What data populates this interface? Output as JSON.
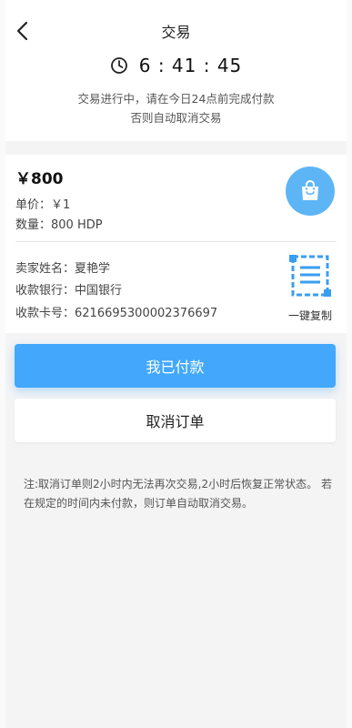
{
  "header": {
    "title": "交易",
    "timer": "6 : 41 : 45",
    "notice_line1": "交易进行中，请在今日24点前完成付款",
    "notice_line2": "否则自动取消交易"
  },
  "order": {
    "amount": "￥800",
    "unit_price": "单价：￥1",
    "quantity": "数量：800 HDP",
    "seller_name": "卖家姓名：夏艳学",
    "bank": "收款银行：中国银行",
    "card_number": "收款卡号：6216695300002376697",
    "copy_label": "一键复制"
  },
  "actions": {
    "paid_label": "我已付款",
    "cancel_label": "取消订单"
  },
  "footer": {
    "note": "注:取消订单则2小时内无法再次交易,2小时后恢复正常状态。 若在规定的时间内未付款，则订单自动取消交易。"
  },
  "colors": {
    "accent": "#43a8fb",
    "bag_icon_bg": "#5db5f5",
    "background": "#f4f4f5"
  },
  "icons": {
    "back": "chevron-left-icon",
    "timer": "clock-icon",
    "bag": "shopping-bag-icon",
    "copy": "document-copy-icon"
  }
}
